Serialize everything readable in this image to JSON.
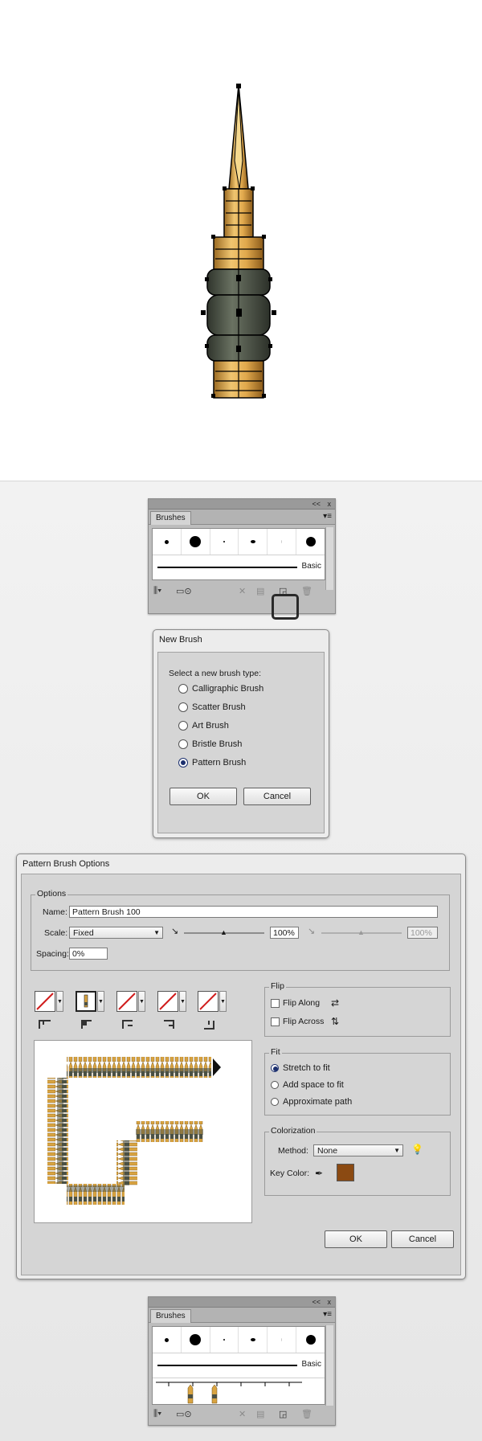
{
  "brushes_panel": {
    "tab_label": "Brushes",
    "basic_label": "Basic",
    "collapse_glyph": "<<",
    "close_glyph": "x",
    "menu_glyph": "▾≡",
    "icons": [
      "libraries-menu-icon",
      "brush-library-icon",
      "remove-stroke-icon",
      "options-icon",
      "new-brush-icon",
      "delete-brush-icon"
    ]
  },
  "new_brush_dialog": {
    "title": "New Brush",
    "prompt": "Select a new brush type:",
    "options": [
      "Calligraphic Brush",
      "Scatter Brush",
      "Art Brush",
      "Bristle Brush",
      "Pattern Brush"
    ],
    "selected": "Pattern Brush",
    "ok_label": "OK",
    "cancel_label": "Cancel"
  },
  "pattern_dialog": {
    "title": "Pattern Brush Options",
    "options_legend": "Options",
    "name_label": "Name:",
    "name_value": "Pattern Brush 100",
    "scale_label": "Scale:",
    "scale_value": "Fixed",
    "scale_percent": "100%",
    "scale_percent2": "100%",
    "spacing_label": "Spacing:",
    "spacing_value": "0%",
    "flip_legend": "Flip",
    "flip_along": "Flip Along",
    "flip_across": "Flip Across",
    "fit_legend": "Fit",
    "fit_options": [
      "Stretch to fit",
      "Add space to fit",
      "Approximate path"
    ],
    "fit_selected": "Stretch to fit",
    "colorization_legend": "Colorization",
    "method_label": "Method:",
    "method_value": "None",
    "key_color_label": "Key Color:",
    "key_color": "#8b4a12",
    "ok_label": "OK",
    "cancel_label": "Cancel"
  },
  "colors": {
    "bullet_gold": "#d9a441",
    "bullet_band": "#4a5044",
    "accent_radio": "#1b2f6e"
  }
}
